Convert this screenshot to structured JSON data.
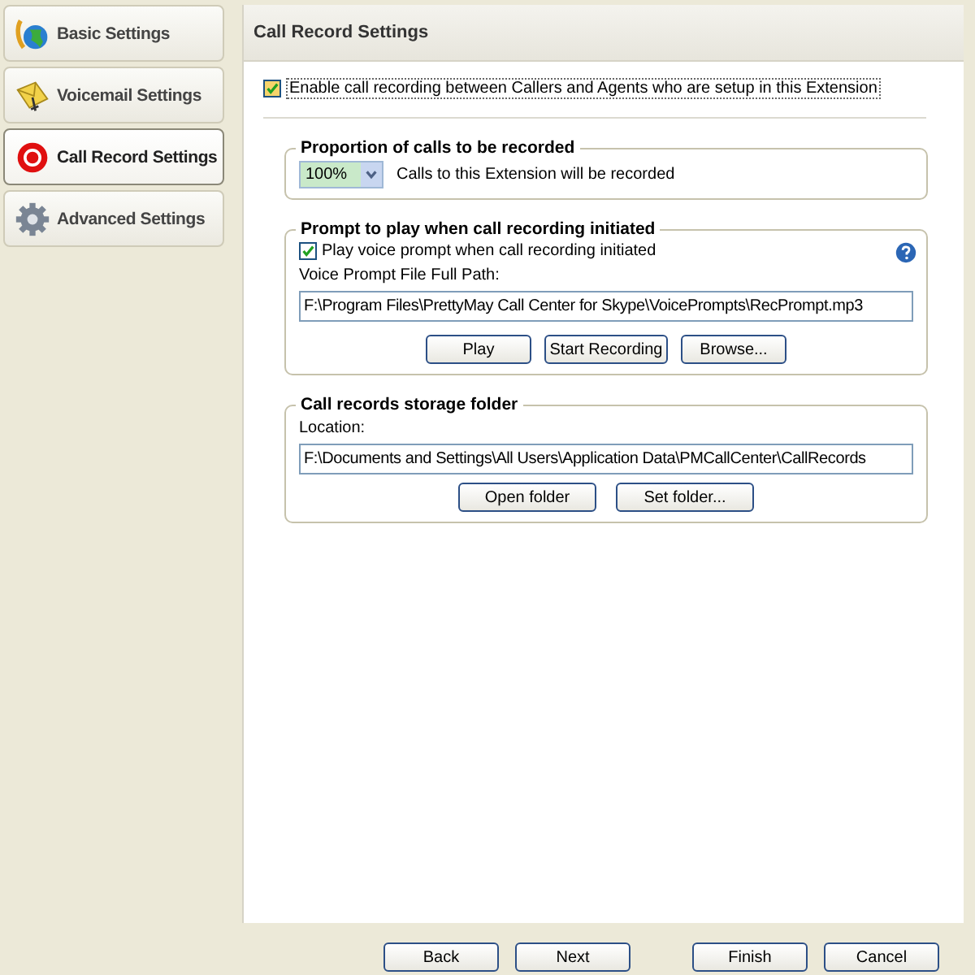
{
  "sidebar": {
    "items": [
      {
        "label": "Basic Settings",
        "selected": false
      },
      {
        "label": "Voicemail Settings",
        "selected": false
      },
      {
        "label": "Call Record Settings",
        "selected": true
      },
      {
        "label": "Advanced Settings",
        "selected": false
      }
    ]
  },
  "panel": {
    "title": "Call Record Settings",
    "enable_checkbox": {
      "label": "Enable call recording between Callers and Agents who are setup in this Extension",
      "checked": true
    },
    "proportion_group": {
      "title": "Proportion of calls to be recorded",
      "dropdown_value": "100%",
      "note": "Calls to this Extension will be recorded"
    },
    "prompt_group": {
      "title": "Prompt to play when call recording initiated",
      "checkbox": {
        "label": "Play voice prompt when call recording initiated",
        "checked": true
      },
      "path_label": "Voice Prompt File Full Path:",
      "path_value": "F:\\Program Files\\PrettyMay Call Center for Skype\\VoicePrompts\\RecPrompt.mp3",
      "buttons": [
        "Play",
        "Start Recording",
        "Browse..."
      ]
    },
    "storage_group": {
      "title": "Call records storage folder",
      "location_label": "Location:",
      "location_value": "F:\\Documents and Settings\\All Users\\Application Data\\PMCallCenter\\CallRecords",
      "buttons": [
        "Open folder",
        "Set folder..."
      ]
    }
  },
  "footer_buttons": [
    "Back",
    "Next",
    "Finish",
    "Cancel"
  ]
}
